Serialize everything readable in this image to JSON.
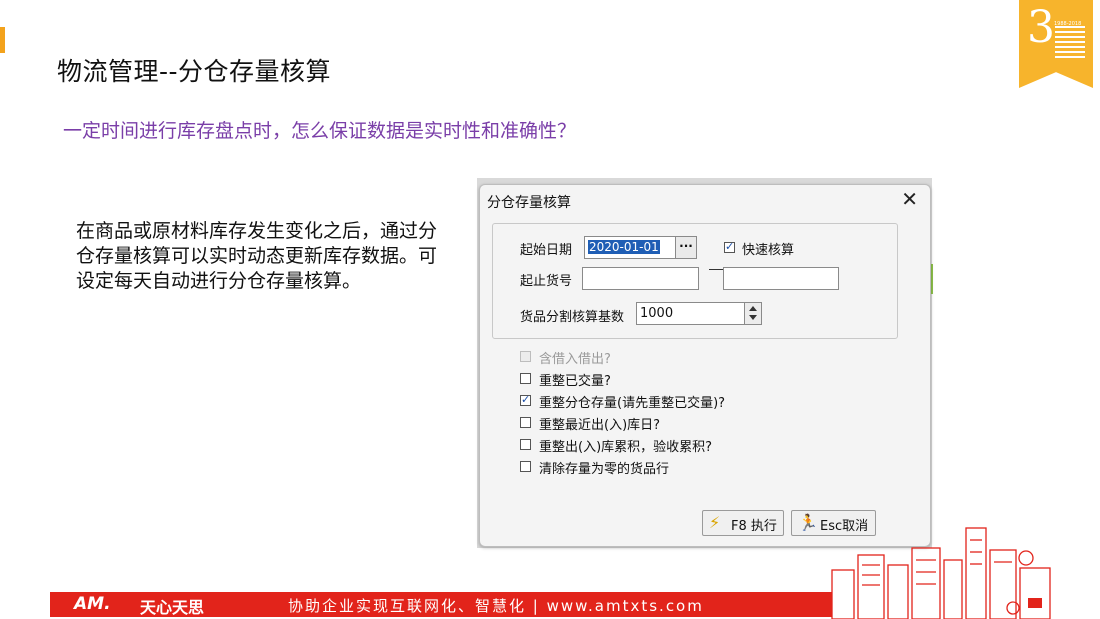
{
  "slide": {
    "title": "物流管理--分仓存量核算",
    "subtitle": "一定时间进行库存盘点时，怎么保证数据是实时性和准确性？",
    "body": "在商品或原材料库存发生变化之后，通过分仓存量核算可以实时动态更新库存数据。可设定每天自动进行分仓存量核算。"
  },
  "badge": {
    "numeral": "3",
    "caption": "1988-2018"
  },
  "dialog": {
    "title": "分仓存量核算",
    "close_glyph": "✕",
    "start_date_label": "起始日期",
    "start_date_value": "2020-01-01",
    "date_picker_glyph": "···",
    "quick_calc_label": "快速核算",
    "quick_calc_checked": true,
    "item_range_label": "起止货号",
    "item_from_value": "",
    "item_to_value": "",
    "split_base_label": "货品分割核算基数",
    "split_base_value": "1000",
    "options": [
      {
        "label": "含借入借出?",
        "checked": false,
        "disabled": true
      },
      {
        "label": "重整已交量?",
        "checked": false,
        "disabled": false
      },
      {
        "label": "重整分仓存量(请先重整已交量)?",
        "checked": true,
        "disabled": false
      },
      {
        "label": "重整最近出(入)库日?",
        "checked": false,
        "disabled": false
      },
      {
        "label": "重整出(入)库累积，验收累积?",
        "checked": false,
        "disabled": false
      },
      {
        "label": "清除存量为零的货品行",
        "checked": false,
        "disabled": false
      }
    ],
    "execute_label": "F8 执行",
    "cancel_label": "Esc取消"
  },
  "footer": {
    "logo": "AM.",
    "brand": "天心天思",
    "slogan": "协助企业实现互联网化、智慧化  |  www.amtxts.com"
  },
  "colors": {
    "accent_orange": "#f3a21c",
    "subtitle_purple": "#7a3ea8",
    "footer_red": "#e2241b",
    "date_highlight": "#1f5eb5"
  }
}
